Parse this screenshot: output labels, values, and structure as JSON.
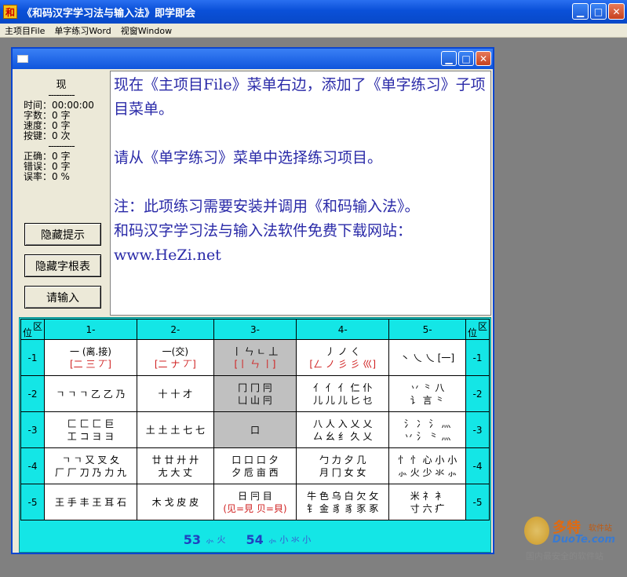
{
  "window": {
    "title": "《和码汉字学习法与输入法》即学即会",
    "icon_char": "和"
  },
  "menu": [
    "主项目File",
    "单字练习Word",
    "视窗Window"
  ],
  "stats": {
    "header": "现",
    "dash": "----------",
    "time": "时间：00:00:00",
    "chars": "字数：0 字",
    "speed": "速度：0 字",
    "keys": "按键：0 次",
    "correct": "正确：0 字",
    "wrong": "错误：0 字",
    "error_rate": "误率：0 %"
  },
  "buttons": {
    "hide_hint": "隐藏提示",
    "hide_table": "隐藏字根表",
    "input": "请输入"
  },
  "message": {
    "line1": "现在《主项目File》菜单右边，添加了《单字练习》子项目菜单。",
    "line2": "请从《单字练习》菜单中选择练习项目。",
    "line3": "注：此项练习需要安装并调用《和码输入法》。",
    "line4": "和码汉字学习法与输入法软件免费下载网站：",
    "line5": "www.HeZi.net"
  },
  "grid": {
    "corner_top": "区",
    "corner_bottom": "位",
    "columns": [
      "1-",
      "2-",
      "3-",
      "4-",
      "5-"
    ],
    "rows": [
      {
        "label": "-1",
        "cells": [
          {
            "top": "一 (离.接)",
            "bottom": "[二 三 丆]"
          },
          {
            "top": "一(交)",
            "bottom": "[二 ナ 丆]"
          },
          {
            "top": "丨 ㄣ ㄴ 丄",
            "bottom": "[丨 ㄣ 丨]"
          },
          {
            "top": "丿 ノ ㄑ",
            "bottom": "[ㄥ ノ 彡 彡 巛]"
          },
          {
            "top": "丶 乀 乀 [一]",
            "bottom": ""
          }
        ]
      },
      {
        "label": "-2",
        "cells": [
          {
            "top": "ㄱ ㄱ ㄱ 乙 乙 乃",
            "bottom": ""
          },
          {
            "top": "十  十  才",
            "bottom": ""
          },
          {
            "top": "冂  冂  冃",
            "bottom": "凵  山  冃"
          },
          {
            "top": "亻 亻 亻 仁 仆",
            "bottom": "儿 儿 儿 匕 乜"
          },
          {
            "top": "丷  ⺀  八",
            "bottom": "讠 言 ⺀"
          }
        ]
      },
      {
        "label": "-3",
        "cells": [
          {
            "top": "匚 匚 匚 巨",
            "bottom": "工 コ ヨ ヨ"
          },
          {
            "top": "土 土 土 七 七",
            "bottom": ""
          },
          {
            "top": "口",
            "bottom": ""
          },
          {
            "top": "八 人 入 乂 乂",
            "bottom": "厶 幺 纟 久 乂"
          },
          {
            "top": "氵 冫 氵 灬",
            "bottom": "丷 氵 ⺀ 灬"
          }
        ]
      },
      {
        "label": "-4",
        "cells": [
          {
            "top": "ㄱ ㄱ 又 叉 夂",
            "bottom": "厂 厂 刀 乃 力 九"
          },
          {
            "top": "廿 廿 廾 廾",
            "bottom": "尢 大 丈"
          },
          {
            "top": "口 口 口 夕",
            "bottom": "夕 卮 亩 西"
          },
          {
            "top": "勹 力 夕 几",
            "bottom": "月 冂 女 女"
          },
          {
            "top": "忄 忄 心 小 小",
            "bottom": "⺗ 火 少 氺 ⺗"
          }
        ]
      },
      {
        "label": "-5",
        "cells": [
          {
            "top": "王 手 丰 王 耳 石",
            "bottom": ""
          },
          {
            "top": "木 戈 皮 皮",
            "bottom": ""
          },
          {
            "top": "日  冃  目",
            "bottom": "(见=見 贝=貝)"
          },
          {
            "top": "牛 色 乌 白 欠 攵",
            "bottom": "钅 金 豸 豸 豕 豖"
          },
          {
            "top": "米 礻 衤",
            "bottom": "寸 六 疒"
          }
        ]
      }
    ],
    "footer": {
      "a_num": "53",
      "a_chars": "⺗ 火",
      "b_num": "54",
      "b_chars": "⺗ 小 氺 小"
    }
  },
  "watermark": {
    "center": "www.DuoTe.com",
    "brand": "多特",
    "brand_small": "软件站",
    "site": "DuoTe.com",
    "tagline": "国内最安全的软件站"
  }
}
